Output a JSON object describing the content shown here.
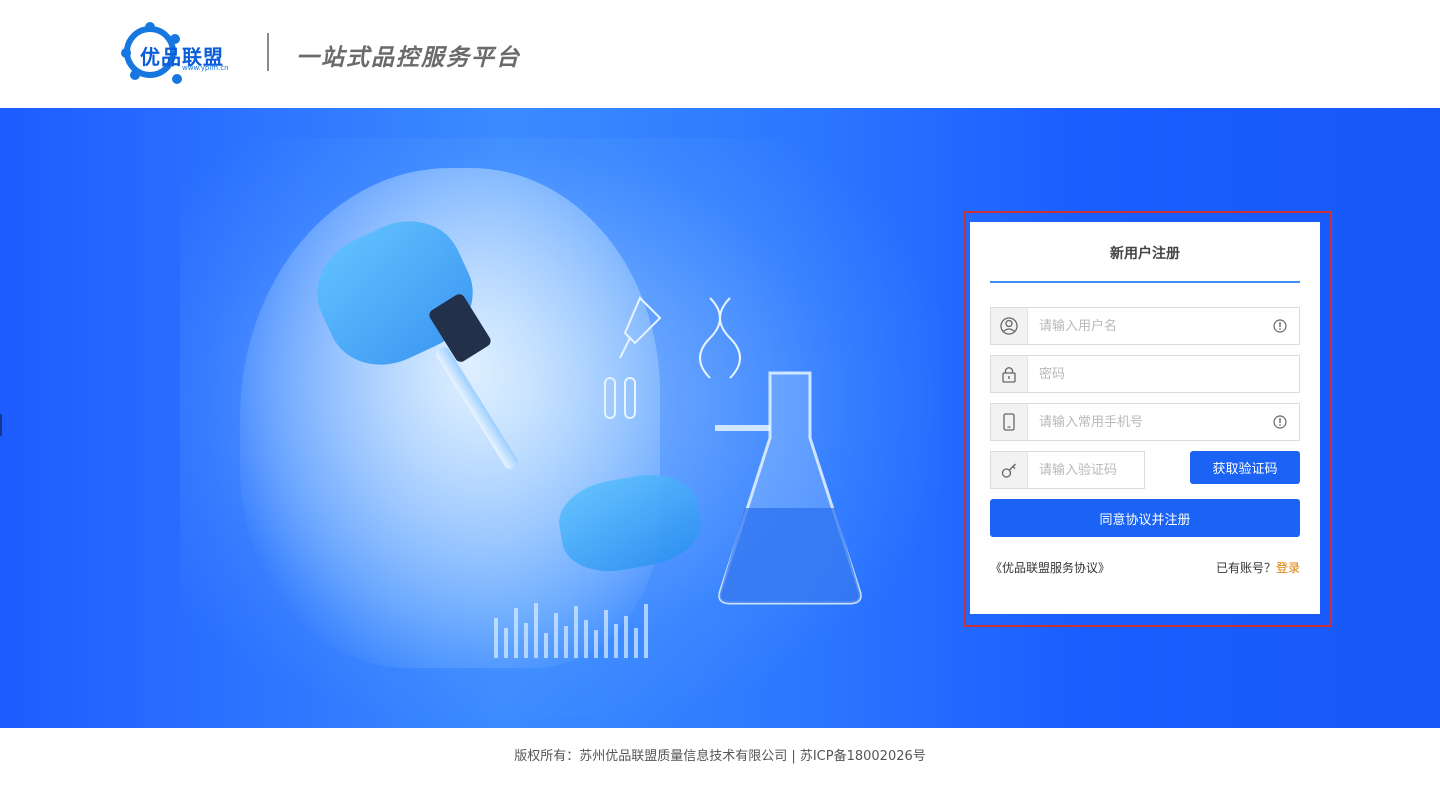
{
  "header": {
    "logo_text": "优品联盟",
    "logo_url_text": "www.yplm.cn",
    "slogan": "一站式品控服务平台"
  },
  "register": {
    "title": "新用户注册",
    "username_placeholder": "请输入用户名",
    "password_placeholder": "密码",
    "phone_placeholder": "请输入常用手机号",
    "code_placeholder": "请输入验证码",
    "get_code_label": "获取验证码",
    "submit_label": "同意协议并注册",
    "agreement_link": "《优品联盟服务协议》",
    "has_account_text": "已有账号？",
    "login_link": "登录"
  },
  "footer": {
    "copyright": "版权所有：苏州优品联盟质量信息技术有限公司 | 苏ICP备18002026号"
  },
  "colors": {
    "primary": "#1a63f5",
    "banner": "#1d5cff",
    "accent_link": "#e07b00",
    "highlight_outline": "#c8323c"
  },
  "icons": {
    "username": "user-circle-icon",
    "password": "lock-icon",
    "phone": "mobile-phone-icon",
    "code": "key-icon",
    "info": "info-circle-icon"
  }
}
